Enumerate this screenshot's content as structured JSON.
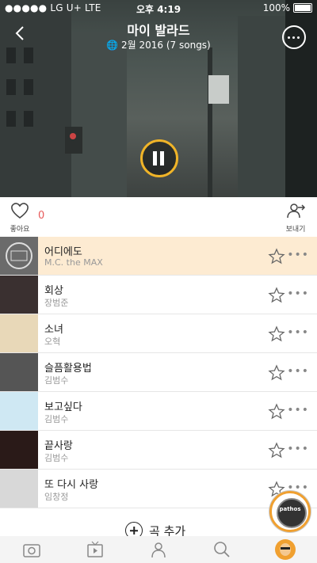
{
  "status": {
    "carrier": "●●●●● LG U+  LTE",
    "time": "오후 4:19",
    "battery": "100%"
  },
  "header": {
    "title": "마이 발라드",
    "subtitle": "2월 2016 (7 songs)"
  },
  "actions": {
    "like_label": "좋아요",
    "like_count": "0",
    "share_label": "보내기"
  },
  "songs": [
    {
      "title": "어디에도",
      "artist": "M.C. the MAX",
      "thumb_color": "#6b6b6b"
    },
    {
      "title": "회상",
      "artist": "장범준",
      "thumb_color": "#3a3030"
    },
    {
      "title": "소녀",
      "artist": "오혁",
      "thumb_color": "#e8d8b8"
    },
    {
      "title": "슬픔활용법",
      "artist": "김범수",
      "thumb_color": "#555"
    },
    {
      "title": "보고싶다",
      "artist": "김범수",
      "thumb_color": "#cfe8f3"
    },
    {
      "title": "끝사랑",
      "artist": "김범수",
      "thumb_color": "#2a1a18"
    },
    {
      "title": "또 다시 사랑",
      "artist": "임창정",
      "thumb_color": "#d8d8d8"
    }
  ],
  "add_song_label": "곡 추가",
  "badge_label": "pathos",
  "colors": {
    "accent": "#f0b428",
    "active_row": "#fdebd2",
    "like_count": "#e75a5a"
  }
}
